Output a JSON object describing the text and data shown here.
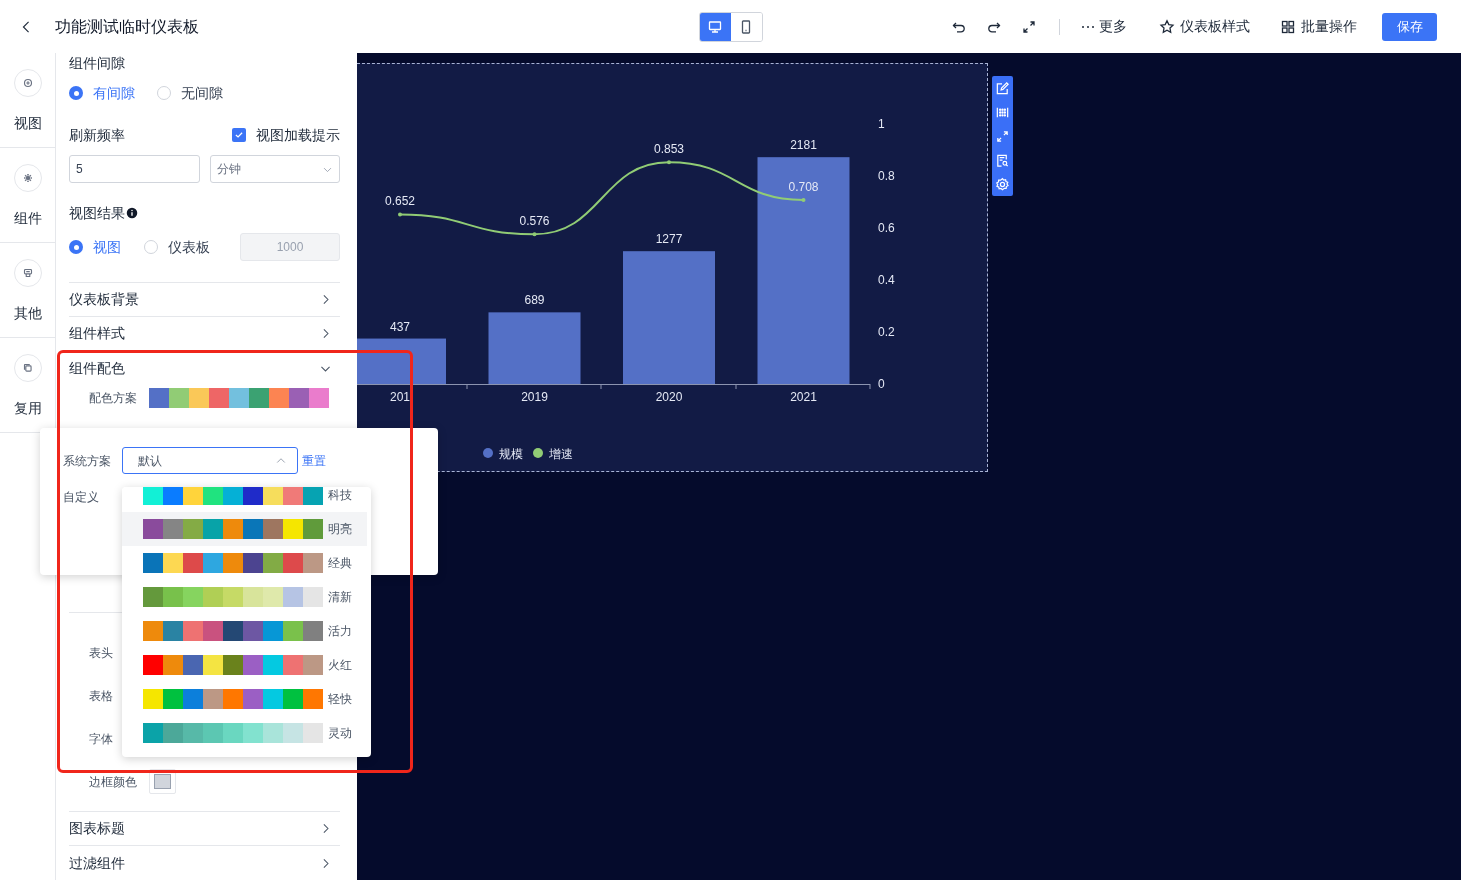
{
  "header": {
    "title": "功能测试临时仪表板",
    "device_toggle": [
      {
        "kind": "desktop",
        "selected": true
      },
      {
        "kind": "mobile",
        "selected": false
      }
    ],
    "actions": [
      {
        "kind": "undo"
      },
      {
        "kind": "redo"
      },
      {
        "kind": "fullscreen"
      },
      {
        "kind": "more",
        "label": "更多"
      },
      {
        "kind": "style",
        "label": "仪表板样式"
      },
      {
        "kind": "batch",
        "label": "批量操作"
      }
    ],
    "save_button": "保存"
  },
  "rail": [
    {
      "kind": "plus",
      "label": "视图"
    },
    {
      "kind": "gear",
      "label": "组件"
    },
    {
      "kind": "other",
      "label": "其他"
    },
    {
      "kind": "copy",
      "label": "复用"
    }
  ],
  "panel": {
    "spacing": {
      "label": "组件间隙",
      "options": [
        {
          "label": "有间隙",
          "selected": true
        },
        {
          "label": "无间隙",
          "selected": false
        }
      ]
    },
    "refresh": {
      "label": "刷新频率",
      "interval": "5",
      "unit": "分钟",
      "load_hint": {
        "label": "视图加载提示",
        "checked": true
      }
    },
    "result": {
      "label": "视图结果",
      "options": [
        {
          "label": "视图",
          "selected": true
        },
        {
          "label": "仪表板",
          "selected": false
        }
      ],
      "limit": {
        "value": "1000",
        "disabled": true
      }
    },
    "sections_top": [
      {
        "label": "仪表板背景",
        "expanded": false
      },
      {
        "label": "组件样式",
        "expanded": false
      },
      {
        "label": "组件配色",
        "expanded": true
      }
    ],
    "palette": {
      "label": "配色方案",
      "colors": [
        {
          "color": "#5470c6"
        },
        {
          "color": "#91cc75"
        },
        {
          "color": "#fac858"
        },
        {
          "color": "#ee6666"
        },
        {
          "color": "#73c0de"
        },
        {
          "color": "#3ba272"
        },
        {
          "color": "#fc8452"
        },
        {
          "color": "#9a60b4"
        },
        {
          "color": "#ea7ccc"
        }
      ]
    },
    "table_colors": [
      {
        "label": "表头"
      },
      {
        "label": "表格"
      },
      {
        "label": "字体"
      },
      {
        "label": "边框颜色"
      }
    ],
    "sections_bottom": [
      {
        "label": "图表标题",
        "expanded": false
      },
      {
        "label": "过滤组件",
        "expanded": false
      }
    ]
  },
  "scheme_popover": {
    "system_label": "系统方案",
    "select_value": "默认",
    "reset_link": "重置",
    "custom_label": "自定义",
    "options": [
      {
        "name": "科技",
        "highlighted": false,
        "colors": [
          {
            "color": "#12f0d6"
          },
          {
            "color": "#0a7cff"
          },
          {
            "color": "#ffd43b"
          },
          {
            "color": "#20e37f"
          },
          {
            "color": "#05b0d6"
          },
          {
            "color": "#1f2bc9"
          },
          {
            "color": "#f6dd5c"
          },
          {
            "color": "#f07a78"
          },
          {
            "color": "#06a3b2"
          }
        ]
      },
      {
        "name": "明亮",
        "highlighted": true,
        "colors": [
          {
            "color": "#8a4b9c"
          },
          {
            "color": "#858585"
          },
          {
            "color": "#84ab45"
          },
          {
            "color": "#08a3a8"
          },
          {
            "color": "#ee8a0c"
          },
          {
            "color": "#0a76b8"
          },
          {
            "color": "#9e7660"
          },
          {
            "color": "#f5e600"
          },
          {
            "color": "#609b3b"
          }
        ]
      },
      {
        "name": "经典",
        "highlighted": false,
        "colors": [
          {
            "color": "#0a74b8"
          },
          {
            "color": "#fdd852"
          },
          {
            "color": "#dd4a4a"
          },
          {
            "color": "#2ea7e0"
          },
          {
            "color": "#ee8a0c"
          },
          {
            "color": "#4c4490"
          },
          {
            "color": "#82ab45"
          },
          {
            "color": "#dd4a4b"
          },
          {
            "color": "#bc9885"
          }
        ]
      },
      {
        "name": "清新",
        "highlighted": false,
        "colors": [
          {
            "color": "#64993c"
          },
          {
            "color": "#78c14b"
          },
          {
            "color": "#86d45f"
          },
          {
            "color": "#b0cf55"
          },
          {
            "color": "#c6da66"
          },
          {
            "color": "#d8e49b"
          },
          {
            "color": "#dfe9ab"
          },
          {
            "color": "#b6c4e4"
          },
          {
            "color": "#e5e5e5"
          }
        ]
      },
      {
        "name": "活力",
        "highlighted": false,
        "colors": [
          {
            "color": "#ee8a0c"
          },
          {
            "color": "#2a83a3"
          },
          {
            "color": "#ee7272"
          },
          {
            "color": "#c9527f"
          },
          {
            "color": "#244874"
          },
          {
            "color": "#6d57a3"
          },
          {
            "color": "#0797d6"
          },
          {
            "color": "#7ac14b"
          },
          {
            "color": "#808080"
          }
        ]
      },
      {
        "name": "火红",
        "highlighted": false,
        "colors": [
          {
            "color": "#ff0000"
          },
          {
            "color": "#ee8a0c"
          },
          {
            "color": "#4a66b1"
          },
          {
            "color": "#f4e442"
          },
          {
            "color": "#6a821c"
          },
          {
            "color": "#9b5fc4"
          },
          {
            "color": "#04c9e1"
          },
          {
            "color": "#ee7272"
          },
          {
            "color": "#bc9885"
          }
        ]
      },
      {
        "name": "轻快",
        "highlighted": false,
        "colors": [
          {
            "color": "#f5e600"
          },
          {
            "color": "#00c13f"
          },
          {
            "color": "#0c7fdb"
          },
          {
            "color": "#bc9885"
          },
          {
            "color": "#ff7700"
          },
          {
            "color": "#9b5fc4"
          },
          {
            "color": "#04c9e1"
          },
          {
            "color": "#00c140"
          },
          {
            "color": "#ff7701"
          }
        ]
      },
      {
        "name": "灵动",
        "highlighted": false,
        "colors": [
          {
            "color": "#0ba3a8"
          },
          {
            "color": "#4ca899"
          },
          {
            "color": "#57b9a8"
          },
          {
            "color": "#5cc7b2"
          },
          {
            "color": "#6ad7c0"
          },
          {
            "color": "#82e2cf"
          },
          {
            "color": "#a9e4da"
          },
          {
            "color": "#c6e4e4"
          },
          {
            "color": "#e5e5e5"
          }
        ]
      }
    ]
  },
  "canvas": {
    "bar_series": {
      "name": "规模",
      "color": "#5470c6",
      "labels": [
        "437",
        "689",
        "1277",
        "2181"
      ]
    },
    "chart_data": {
      "type": "line",
      "categories": [
        "201",
        "2019",
        "2020",
        "2021"
      ],
      "yticks": [
        0,
        0.2,
        0.4,
        0.6,
        0.8,
        1
      ],
      "ylim": [
        0,
        1
      ],
      "data_labels": true,
      "series": [
        {
          "name": "增速",
          "color": "#91cc75",
          "values": [
            0.652,
            0.576,
            0.853,
            0.708
          ]
        }
      ]
    },
    "toolbar": [
      {
        "kind": "edit"
      },
      {
        "kind": "grid"
      },
      {
        "kind": "expand"
      },
      {
        "kind": "inspect"
      },
      {
        "kind": "settings"
      }
    ]
  },
  "annotation_frame": {
    "shown": true
  }
}
